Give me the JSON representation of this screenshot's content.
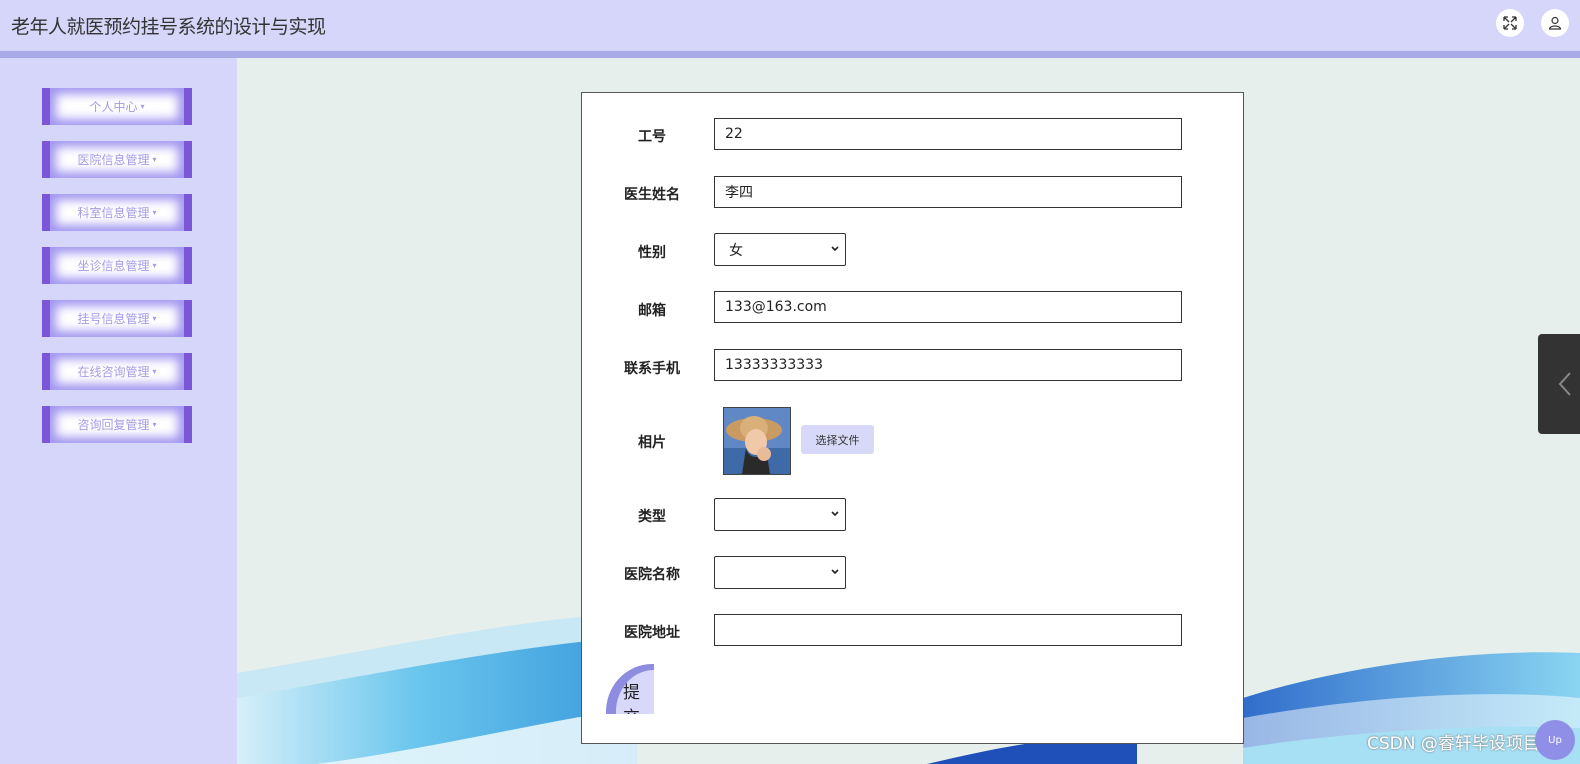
{
  "header": {
    "title": "老年人就医预约挂号系统的设计与实现",
    "icons": [
      "fullscreen-icon",
      "user-icon"
    ]
  },
  "sidebar": {
    "items": [
      {
        "label": "个人中心"
      },
      {
        "label": "医院信息管理"
      },
      {
        "label": "科室信息管理"
      },
      {
        "label": "坐诊信息管理"
      },
      {
        "label": "挂号信息管理"
      },
      {
        "label": "在线咨询管理"
      },
      {
        "label": "咨询回复管理"
      }
    ],
    "caret": "▾"
  },
  "form": {
    "job_no": {
      "label": "工号",
      "value": "22"
    },
    "doctor_name": {
      "label": "医生姓名",
      "value": "李四"
    },
    "gender": {
      "label": "性别",
      "value": "女"
    },
    "email": {
      "label": "邮箱",
      "value": "133@163.com"
    },
    "phone": {
      "label": "联系手机",
      "value": "13333333333"
    },
    "photo": {
      "label": "相片",
      "button": "选择文件"
    },
    "type": {
      "label": "类型",
      "value": ""
    },
    "hospital_name": {
      "label": "医院名称",
      "value": ""
    },
    "hospital_address": {
      "label": "医院地址",
      "value": ""
    },
    "submit_label": "提交"
  },
  "watermark": "CSDN @睿轩毕设项目",
  "help_bubble": "Up",
  "colors": {
    "header_bg": "#d6d6fa",
    "accent": "#7b57d8",
    "content_bg": "#e6efec"
  }
}
